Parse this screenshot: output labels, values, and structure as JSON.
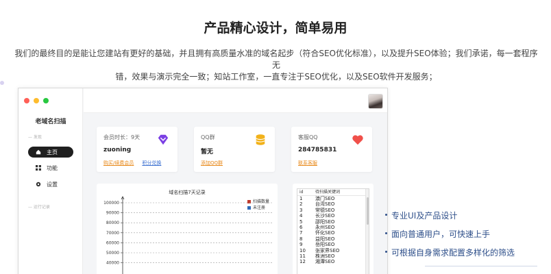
{
  "section": {
    "title": "产品精心设计，简单易用",
    "intro_line1": "我们的最终目的是能让您建站有更好的基础，并且拥有高质量水准的域名起步（符合SEO优化标准），以及提升SEO体验；我们承诺，每一套程序无",
    "intro_line2": "错，效果与演示完全一致；知站工作室，一直专注于SEO优化，以及SEO软件开发服务；"
  },
  "app": {
    "title": "老域名扫描",
    "section_main": "— 发现",
    "section_records": "— 运行记录",
    "nav": [
      {
        "label": "主页",
        "icon": "home-icon",
        "active": true
      },
      {
        "label": "功能",
        "icon": "grid-icon",
        "active": false
      },
      {
        "label": "设置",
        "icon": "settings-icon",
        "active": false
      }
    ],
    "window_dots": [
      "#ff5f57",
      "#febc2e",
      "#28c840"
    ]
  },
  "cards": {
    "member": {
      "label": "会员时长：9天",
      "value": "zuoning",
      "link1": "购买/续费会员",
      "link2": "积分兑换",
      "icon": "diamond-icon"
    },
    "qq_group": {
      "label": "QQ群",
      "value": "暂无",
      "link1": "添加QQ群",
      "icon": "coins-icon"
    },
    "service": {
      "label": "客服QQ",
      "value": "284785831",
      "link1": "联系客服",
      "icon": "heart-icon"
    }
  },
  "colors": {
    "link_orange": "#e8891a",
    "link_blue": "#3a6fd0",
    "diamond": "#7b3fe4",
    "coins": "#f2b21b",
    "heart": "#f0504a",
    "feature_text": "#2e4f8a"
  },
  "chart_data": {
    "type": "bar",
    "title": "域名扫描7天记录",
    "ylim": [
      0,
      100000
    ],
    "yticks": [
      100000,
      90000,
      80000,
      70000,
      60000,
      50000,
      40000
    ],
    "grid": true,
    "legend_position": "top-right",
    "series": [
      {
        "name": "扫描数量",
        "color": "#c0392b",
        "values": []
      },
      {
        "name": "未注册",
        "color": "#2f6ab7",
        "values": []
      }
    ]
  },
  "keyword_list": {
    "headers": [
      "id",
      "待扫描关键词"
    ],
    "rows": [
      {
        "id": "1",
        "kw": "澳门SEO"
      },
      {
        "id": "2",
        "kw": "台湾SEO"
      },
      {
        "id": "3",
        "kw": "常德SEO"
      },
      {
        "id": "4",
        "kw": "长沙SEO"
      },
      {
        "id": "5",
        "kw": "邵阳SEO"
      },
      {
        "id": "6",
        "kw": "永州SEO"
      },
      {
        "id": "7",
        "kw": "怀化SEO"
      },
      {
        "id": "8",
        "kw": "益阳SEO"
      },
      {
        "id": "9",
        "kw": "岳阳SEO"
      },
      {
        "id": "10",
        "kw": "张家界SEO"
      },
      {
        "id": "11",
        "kw": "株洲SEO"
      },
      {
        "id": "12",
        "kw": "湘潭SEO"
      }
    ]
  },
  "features": [
    "专业UI及产品设计",
    "面向普通用户，可快速上手",
    "可根据自身需求配置多样化的筛选"
  ]
}
